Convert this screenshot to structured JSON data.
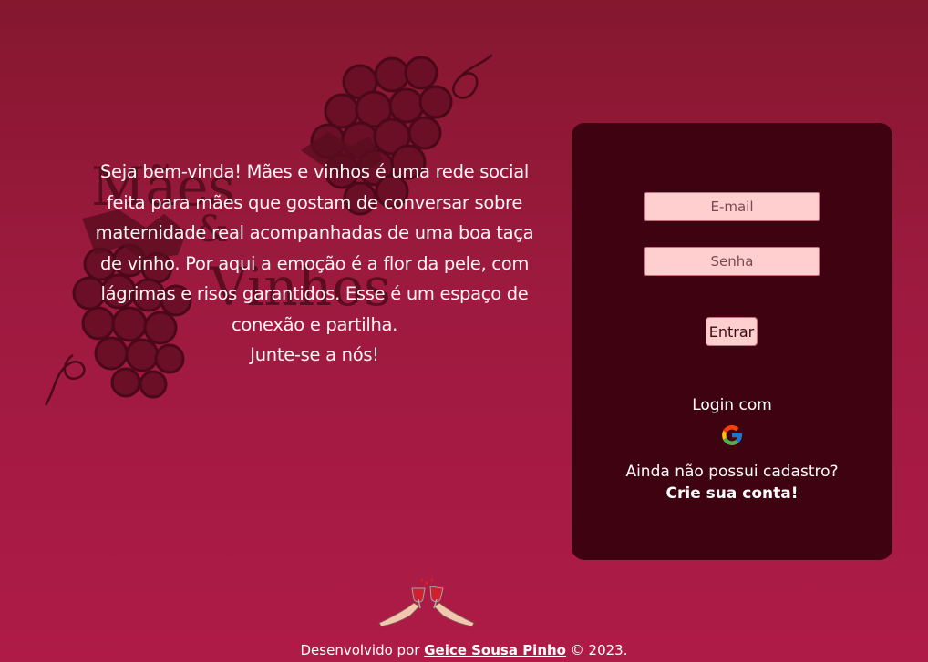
{
  "background_watermark": {
    "logo_text": [
      "Mães",
      "&",
      "Vinhos"
    ],
    "icon": "grape-bunch-icon"
  },
  "intro": {
    "text": "Seja bem-vinda! Mães e vinhos é uma rede social feita para mães que gostam de conversar sobre maternidade real acompanhadas de uma boa taça de vinho. Por aqui a emoção é a flor da pele, com lágrimas e risos garantidos. Esse é um espaço de conexão e partilha.",
    "cta": "Junte-se a nós!"
  },
  "login": {
    "email_placeholder": "E-mail",
    "password_placeholder": "Senha",
    "submit_label": "Entrar",
    "login_with_label": "Login com",
    "google_icon": "google-icon",
    "no_account_text": "Ainda não possui cadastro?",
    "create_account_link": "Crie sua conta!"
  },
  "footer": {
    "prefix": "Desenvolvido por",
    "author": "Geice Sousa Pinho",
    "suffix": "© 2023.",
    "icon": "wine-toast-icon"
  },
  "colors": {
    "background_top": "#85172f",
    "background_bottom": "#ae1b47",
    "card": "#3f0210",
    "input_fill": "#ffcfcf",
    "grape": "#5a0d1f"
  }
}
